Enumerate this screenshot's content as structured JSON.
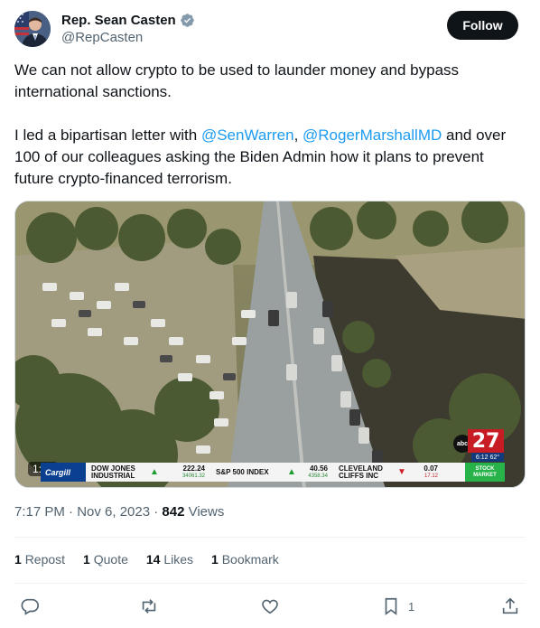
{
  "author": {
    "display_name": "Rep. Sean Casten",
    "handle": "@RepCasten",
    "avatar": "avatar-photo",
    "verified_icon": "verified-badge-icon"
  },
  "follow_label": "Follow",
  "tweet": {
    "text_1": "We can not allow crypto to be used to launder money and bypass international sanctions.\n\nI led a bipartisan letter with ",
    "mention_1": "@SenWarren",
    "text_2": ", ",
    "mention_2": "@RogerMarshallMD",
    "text_3": " and over 100 of our colleagues asking the Biden Admin how it plans to prevent future crypto-financed terrorism."
  },
  "media": {
    "duration": "1:00",
    "ticker": {
      "sponsor": "Cargill",
      "items": [
        {
          "name": "DOW JONES INDUSTRIAL",
          "value": "222.24",
          "sub": "34061.32",
          "direction": "up"
        },
        {
          "name": "S&P 500 INDEX",
          "value": "40.56",
          "sub": "4358.34",
          "direction": "up"
        },
        {
          "name": "CLEVELAND CLIFFS INC",
          "value": "0.07",
          "sub": "17.12",
          "direction": "down"
        }
      ],
      "badge": "STOCK MARKET"
    },
    "station": {
      "network": "abc",
      "channel": "27",
      "clock": "6:12 62°"
    }
  },
  "meta": {
    "time_date": "7:17 PM · Nov 6, 2023 · ",
    "views_count": "842",
    "views_label": " Views"
  },
  "stats": [
    {
      "count": "1",
      "label": "Repost"
    },
    {
      "count": "1",
      "label": "Quote"
    },
    {
      "count": "14",
      "label": "Likes"
    },
    {
      "count": "1",
      "label": "Bookmark"
    }
  ],
  "actions": {
    "bookmark_count": "1"
  }
}
